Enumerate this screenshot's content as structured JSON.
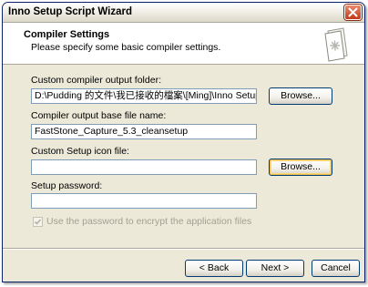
{
  "window": {
    "title": "Inno Setup Script Wizard"
  },
  "header": {
    "title": "Compiler Settings",
    "subtitle": "Please specify some basic compiler settings."
  },
  "form": {
    "output_folder_label": "Custom compiler output folder:",
    "output_folder_value": "D:\\Pudding 的文件\\我已接收的檔案\\[Ming]\\Inno Setup 綠色版",
    "output_basename_label": "Compiler output base file name:",
    "output_basename_value": "FastStone_Capture_5.3_cleansetup",
    "icon_file_label": "Custom Setup icon file:",
    "icon_file_value": "",
    "password_label": "Setup password:",
    "password_value": "",
    "encrypt_label": "Use the password to encrypt the application files",
    "encrypt_checked": true
  },
  "buttons": {
    "browse": "Browse...",
    "back": "< Back",
    "next": "Next >",
    "cancel": "Cancel"
  },
  "icons": {
    "close": "close-icon",
    "wizard": "wizard-document-icon",
    "check": "checkmark-icon"
  },
  "colors": {
    "window_bg": "#ece9d8",
    "close_button": "#c2381a",
    "input_border": "#7f9db9",
    "disabled_text": "#a0a094"
  }
}
